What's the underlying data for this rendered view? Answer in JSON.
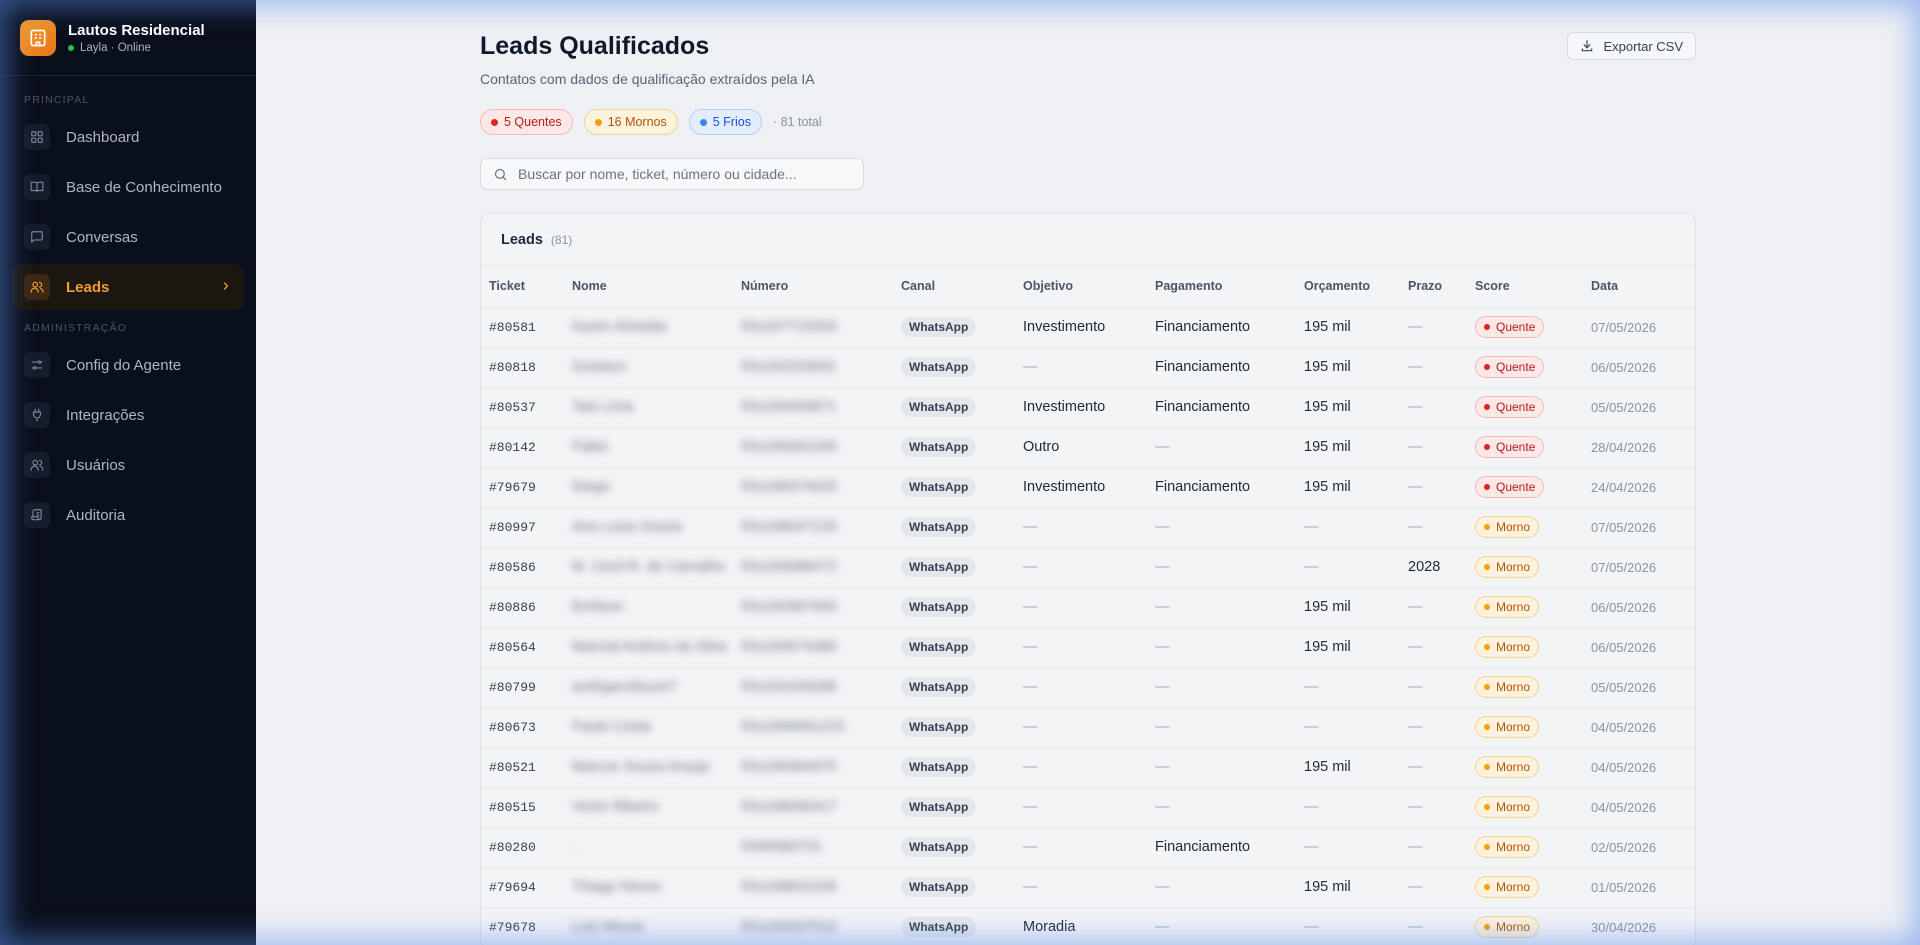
{
  "brand": {
    "name": "Lautos Residencial",
    "status": "Layla · Online"
  },
  "sidebar": {
    "section_principal": "PRINCIPAL",
    "section_admin": "ADMINISTRAÇÃO",
    "items": [
      {
        "label": "Dashboard",
        "icon": "grid-icon"
      },
      {
        "label": "Base de Conhecimento",
        "icon": "book-icon"
      },
      {
        "label": "Conversas",
        "icon": "chat-icon"
      },
      {
        "label": "Leads",
        "icon": "users-icon"
      },
      {
        "label": "Config do Agente",
        "icon": "sliders-icon"
      },
      {
        "label": "Integrações",
        "icon": "plug-icon"
      },
      {
        "label": "Usuários",
        "icon": "users-icon"
      },
      {
        "label": "Auditoria",
        "icon": "scroll-icon"
      }
    ]
  },
  "page": {
    "title": "Leads Qualificados",
    "subtitle": "Contatos com dados de qualificação extraídos pela IA",
    "export_label": "Exportar CSV"
  },
  "summary": {
    "hot": "5 Quentes",
    "warm": "16 Mornos",
    "cold": "5 Frios",
    "total": "· 81 total"
  },
  "search": {
    "placeholder": "Buscar por nome, ticket, número ou cidade..."
  },
  "table": {
    "title": "Leads",
    "count": "(81)",
    "columns": [
      "Ticket",
      "Nome",
      "Número",
      "Canal",
      "Objetivo",
      "Pagamento",
      "Orçamento",
      "Prazo",
      "Score",
      "Data"
    ],
    "rows": [
      {
        "ticket": "#80581",
        "nome": "Karen Almeida",
        "numero": "551197715353",
        "canal": "WhatsApp",
        "objetivo": "Investimento",
        "pagamento": "Financiamento",
        "orcamento": "195 mil",
        "prazo": "—",
        "score": "Quente",
        "level": "hot",
        "data": "07/05/2026"
      },
      {
        "ticket": "#80818",
        "nome": "Gustavo",
        "numero": "551192233001",
        "canal": "WhatsApp",
        "objetivo": "—",
        "pagamento": "Financiamento",
        "orcamento": "195 mil",
        "prazo": "—",
        "score": "Quente",
        "level": "hot",
        "data": "06/05/2026"
      },
      {
        "ticket": "#80537",
        "nome": "Tais Lima",
        "numero": "551193456871",
        "canal": "WhatsApp",
        "objetivo": "Investimento",
        "pagamento": "Financiamento",
        "orcamento": "195 mil",
        "prazo": "—",
        "score": "Quente",
        "level": "hot",
        "data": "05/05/2026"
      },
      {
        "ticket": "#80142",
        "nome": "Fabio",
        "numero": "551199281200",
        "canal": "WhatsApp",
        "objetivo": "Outro",
        "pagamento": "—",
        "orcamento": "195 mil",
        "prazo": "—",
        "score": "Quente",
        "level": "hot",
        "data": "28/04/2026"
      },
      {
        "ticket": "#79679",
        "nome": "Diego",
        "numero": "551198374020",
        "canal": "WhatsApp",
        "objetivo": "Investimento",
        "pagamento": "Financiamento",
        "orcamento": "195 mil",
        "prazo": "—",
        "score": "Quente",
        "level": "hot",
        "data": "24/04/2026"
      },
      {
        "ticket": "#80997",
        "nome": "Ana Luiza Souza",
        "numero": "551198047133",
        "canal": "WhatsApp",
        "objetivo": "—",
        "pagamento": "—",
        "orcamento": "—",
        "prazo": "—",
        "score": "Morno",
        "level": "warm",
        "data": "07/05/2026"
      },
      {
        "ticket": "#80586",
        "nome": "M. Cecil R. de Carvalho",
        "numero": "551193088472",
        "canal": "WhatsApp",
        "objetivo": "—",
        "pagamento": "—",
        "orcamento": "—",
        "prazo": "2028",
        "score": "Morno",
        "level": "warm",
        "data": "07/05/2026"
      },
      {
        "ticket": "#80886",
        "nome": "Emilson",
        "numero": "551192987650",
        "canal": "WhatsApp",
        "objetivo": "—",
        "pagamento": "—",
        "orcamento": "195 mil",
        "prazo": "—",
        "score": "Morno",
        "level": "warm",
        "data": "06/05/2026"
      },
      {
        "ticket": "#80564",
        "nome": "Marcial Antônio da Silva",
        "numero": "551193974380",
        "canal": "WhatsApp",
        "objetivo": "—",
        "pagamento": "—",
        "orcamento": "195 mil",
        "prazo": "—",
        "score": "Morno",
        "level": "warm",
        "data": "06/05/2026"
      },
      {
        "ticket": "#80799",
        "nome": "andrgarcdouze7",
        "numero": "551191033289",
        "canal": "WhatsApp",
        "objetivo": "—",
        "pagamento": "—",
        "orcamento": "—",
        "prazo": "—",
        "score": "Morno",
        "level": "warm",
        "data": "05/05/2026"
      },
      {
        "ticket": "#80673",
        "nome": "Paulo Costa",
        "numero": "5511999991215",
        "canal": "WhatsApp",
        "objetivo": "—",
        "pagamento": "—",
        "orcamento": "—",
        "prazo": "—",
        "score": "Morno",
        "level": "warm",
        "data": "04/05/2026"
      },
      {
        "ticket": "#80521",
        "nome": "Marcos Souza Araujo",
        "numero": "551196484970",
        "canal": "WhatsApp",
        "objetivo": "—",
        "pagamento": "—",
        "orcamento": "195 mil",
        "prazo": "—",
        "score": "Morno",
        "level": "warm",
        "data": "04/05/2026"
      },
      {
        "ticket": "#80515",
        "nome": "Victor Ribeiro",
        "numero": "551198066417",
        "canal": "WhatsApp",
        "objetivo": "—",
        "pagamento": "—",
        "orcamento": "—",
        "prazo": "—",
        "score": "Morno",
        "level": "warm",
        "data": "04/05/2026"
      },
      {
        "ticket": "#80280",
        "nome": ".",
        "numero": "5599580731",
        "canal": "WhatsApp",
        "objetivo": "—",
        "pagamento": "Financiamento",
        "orcamento": "—",
        "prazo": "—",
        "score": "Morno",
        "level": "warm",
        "data": "02/05/2026"
      },
      {
        "ticket": "#79694",
        "nome": "Thiago Neves",
        "numero": "551198831209",
        "canal": "WhatsApp",
        "objetivo": "—",
        "pagamento": "—",
        "orcamento": "195 mil",
        "prazo": "—",
        "score": "Morno",
        "level": "warm",
        "data": "01/05/2026"
      },
      {
        "ticket": "#79678",
        "nome": "Luiz Moura",
        "numero": "551193337512",
        "canal": "WhatsApp",
        "objetivo": "Moradia",
        "pagamento": "—",
        "orcamento": "—",
        "prazo": "—",
        "score": "Morno",
        "level": "warm",
        "data": "30/04/2026"
      }
    ]
  },
  "colors": {
    "accent": "#f59e2b",
    "sidebar_bg": "#0a0f1c",
    "hot": "#dc2626",
    "warm": "#f59e0b",
    "cold": "#3b82f6"
  }
}
